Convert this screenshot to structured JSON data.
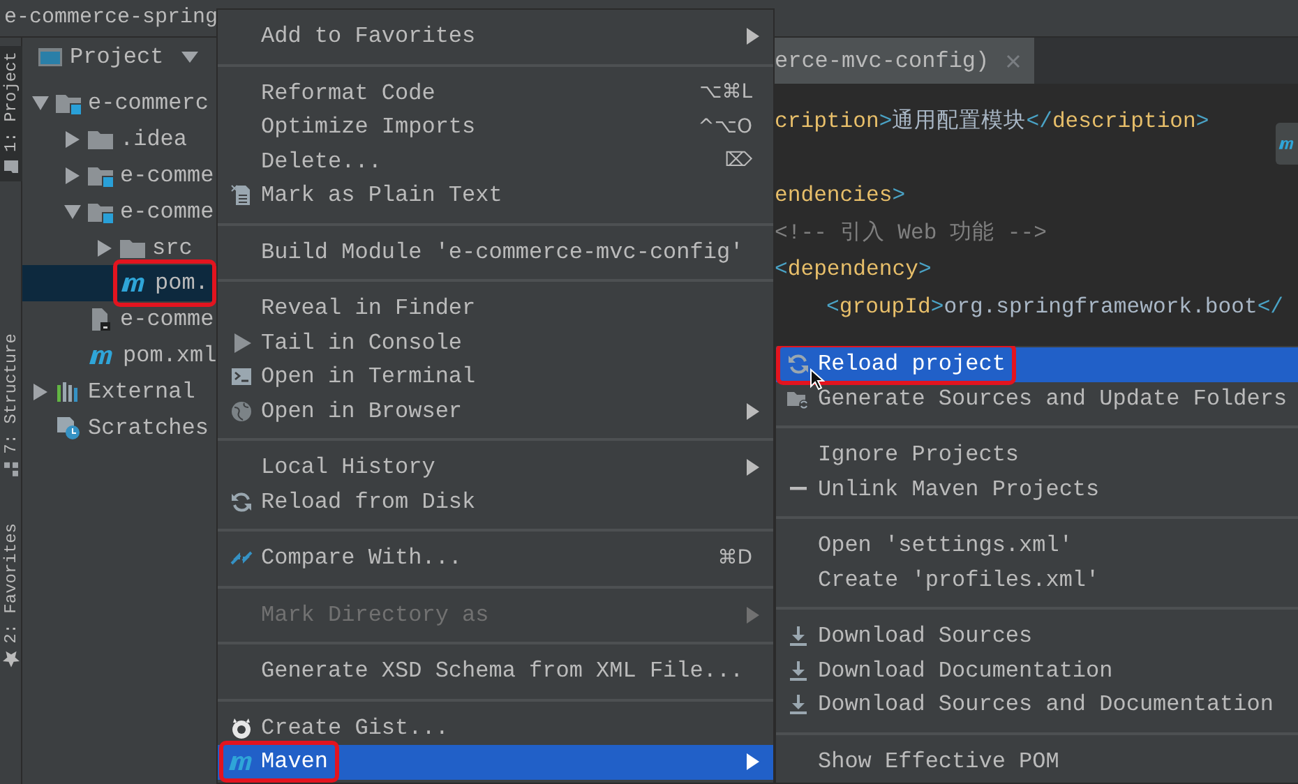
{
  "title_bar": {
    "title": "e-commerce-spring"
  },
  "tool_windows": [
    {
      "label": "1: Project",
      "selected": true
    },
    {
      "label": "7: Structure",
      "selected": false
    },
    {
      "label": "2: Favorites",
      "selected": false
    }
  ],
  "project_panel": {
    "title": "Project",
    "tree": [
      {
        "label": "e-commerc",
        "kind": "module-folder",
        "expanded": true,
        "selected": false,
        "highlighted": false,
        "children": [
          {
            "label": ".idea",
            "kind": "folder",
            "expanded": false,
            "selected": false,
            "highlighted": false
          },
          {
            "label": "e-comme",
            "kind": "module-folder",
            "expanded": false,
            "selected": false,
            "highlighted": false
          },
          {
            "label": "e-comme",
            "kind": "module-folder",
            "expanded": true,
            "selected": false,
            "highlighted": false,
            "children": [
              {
                "label": "src",
                "kind": "folder",
                "expanded": false,
                "selected": false,
                "highlighted": false
              },
              {
                "label": "pom.",
                "kind": "maven-file",
                "selected": true,
                "highlighted": true
              }
            ]
          },
          {
            "label": "e-comme",
            "kind": "file",
            "selected": false,
            "highlighted": false
          },
          {
            "label": "pom.xml",
            "kind": "maven-file",
            "selected": false,
            "highlighted": false
          }
        ]
      },
      {
        "label": "External",
        "kind": "library",
        "expanded": false,
        "selected": false,
        "highlighted": false
      },
      {
        "label": "Scratches",
        "kind": "scratches",
        "selected": false,
        "highlighted": false
      }
    ]
  },
  "editor": {
    "tab": {
      "label": "erce-mvc-config)"
    },
    "blocks": [
      [
        {
          "segments": [
            {
              "kind": "tag",
              "text": "cription"
            },
            {
              "kind": "bracket",
              "text": ">"
            },
            {
              "kind": "text",
              "text": "通用配置模块"
            },
            {
              "kind": "bracket",
              "text": "</"
            },
            {
              "kind": "tag",
              "text": "description"
            },
            {
              "kind": "bracket",
              "text": ">"
            }
          ]
        }
      ],
      [
        {
          "segments": [
            {
              "kind": "tag",
              "text": "endencies"
            },
            {
              "kind": "bracket",
              "text": ">"
            }
          ]
        },
        {
          "segments": [
            {
              "kind": "comment",
              "text": "<!-- 引入 Web 功能 -->"
            }
          ]
        },
        {
          "segments": [
            {
              "kind": "bracket",
              "text": "<"
            },
            {
              "kind": "tag",
              "text": "dependency"
            },
            {
              "kind": "bracket",
              "text": ">"
            }
          ],
          "children": [
            {
              "segments": [
                {
                  "kind": "bracket",
                  "text": "<"
                },
                {
                  "kind": "tag",
                  "text": "groupId"
                },
                {
                  "kind": "bracket",
                  "text": ">"
                },
                {
                  "kind": "text",
                  "text": "org.springframework.boot"
                },
                {
                  "kind": "bracket",
                  "text": "</"
                }
              ]
            }
          ]
        }
      ]
    ]
  },
  "context_menu": {
    "items": [
      {
        "kind": "item",
        "label": "Add to Favorites",
        "submenu": true,
        "disabled": false,
        "selected": false,
        "highlighted": false
      },
      {
        "kind": "separator"
      },
      {
        "kind": "item",
        "label": "Reformat Code",
        "shortcut": "⌥⌘L",
        "submenu": false,
        "disabled": false,
        "selected": false,
        "highlighted": false
      },
      {
        "kind": "item",
        "label": "Optimize Imports",
        "shortcut": "^⌥O",
        "submenu": false,
        "disabled": false,
        "selected": false,
        "highlighted": false
      },
      {
        "kind": "item",
        "label": "Delete...",
        "shortcut": "⌦",
        "submenu": false,
        "disabled": false,
        "selected": false,
        "highlighted": false
      },
      {
        "kind": "item",
        "label": "Mark as Plain Text",
        "submenu": false,
        "disabled": false,
        "selected": false,
        "highlighted": false
      },
      {
        "kind": "separator"
      },
      {
        "kind": "item",
        "label": "Build Module 'e-commerce-mvc-config'",
        "submenu": false,
        "disabled": false,
        "selected": false,
        "highlighted": false
      },
      {
        "kind": "separator"
      },
      {
        "kind": "item",
        "label": "Reveal in Finder",
        "submenu": false,
        "disabled": false,
        "selected": false,
        "highlighted": false
      },
      {
        "kind": "item",
        "label": "Tail in Console",
        "submenu": false,
        "disabled": false,
        "selected": false,
        "highlighted": false
      },
      {
        "kind": "item",
        "label": "Open in Terminal",
        "submenu": false,
        "disabled": false,
        "selected": false,
        "highlighted": false
      },
      {
        "kind": "item",
        "label": "Open in Browser",
        "submenu": true,
        "disabled": false,
        "selected": false,
        "highlighted": false
      },
      {
        "kind": "separator"
      },
      {
        "kind": "item",
        "label": "Local History",
        "submenu": true,
        "disabled": false,
        "selected": false,
        "highlighted": false
      },
      {
        "kind": "item",
        "label": "Reload from Disk",
        "submenu": false,
        "disabled": false,
        "selected": false,
        "highlighted": false
      },
      {
        "kind": "separator"
      },
      {
        "kind": "item",
        "label": "Compare With...",
        "shortcut": "⌘D",
        "submenu": false,
        "disabled": false,
        "selected": false,
        "highlighted": false
      },
      {
        "kind": "separator"
      },
      {
        "kind": "item",
        "label": "Mark Directory as",
        "submenu": true,
        "disabled": true,
        "selected": false,
        "highlighted": false
      },
      {
        "kind": "separator"
      },
      {
        "kind": "item",
        "label": "Generate XSD Schema from XML File...",
        "submenu": false,
        "disabled": false,
        "selected": false,
        "highlighted": false
      },
      {
        "kind": "separator"
      },
      {
        "kind": "item",
        "label": "Create Gist...",
        "submenu": false,
        "disabled": false,
        "selected": false,
        "highlighted": false
      },
      {
        "kind": "item",
        "label": "Maven",
        "submenu": true,
        "disabled": false,
        "selected": true,
        "highlighted": true
      }
    ]
  },
  "maven_submenu": {
    "items": [
      {
        "kind": "item",
        "label": "Reload project",
        "submenu": false,
        "disabled": false,
        "selected": true,
        "highlighted": true
      },
      {
        "kind": "item",
        "label": "Generate Sources and Update Folders",
        "submenu": false,
        "disabled": false,
        "selected": false,
        "highlighted": false
      },
      {
        "kind": "separator"
      },
      {
        "kind": "item",
        "label": "Ignore Projects",
        "submenu": false,
        "disabled": false,
        "selected": false,
        "highlighted": false
      },
      {
        "kind": "item",
        "label": "Unlink Maven Projects",
        "submenu": false,
        "disabled": false,
        "selected": false,
        "highlighted": false
      },
      {
        "kind": "separator"
      },
      {
        "kind": "item",
        "label": "Open 'settings.xml'",
        "submenu": false,
        "disabled": false,
        "selected": false,
        "highlighted": false
      },
      {
        "kind": "item",
        "label": "Create 'profiles.xml'",
        "submenu": false,
        "disabled": false,
        "selected": false,
        "highlighted": false
      },
      {
        "kind": "separator"
      },
      {
        "kind": "item",
        "label": "Download Sources",
        "submenu": false,
        "disabled": false,
        "selected": false,
        "highlighted": false
      },
      {
        "kind": "item",
        "label": "Download Documentation",
        "submenu": false,
        "disabled": false,
        "selected": false,
        "highlighted": false
      },
      {
        "kind": "item",
        "label": "Download Sources and Documentation",
        "submenu": false,
        "disabled": false,
        "selected": false,
        "highlighted": false
      },
      {
        "kind": "separator"
      },
      {
        "kind": "item",
        "label": "Show Effective POM",
        "submenu": false,
        "disabled": false,
        "selected": false,
        "highlighted": false
      }
    ]
  }
}
